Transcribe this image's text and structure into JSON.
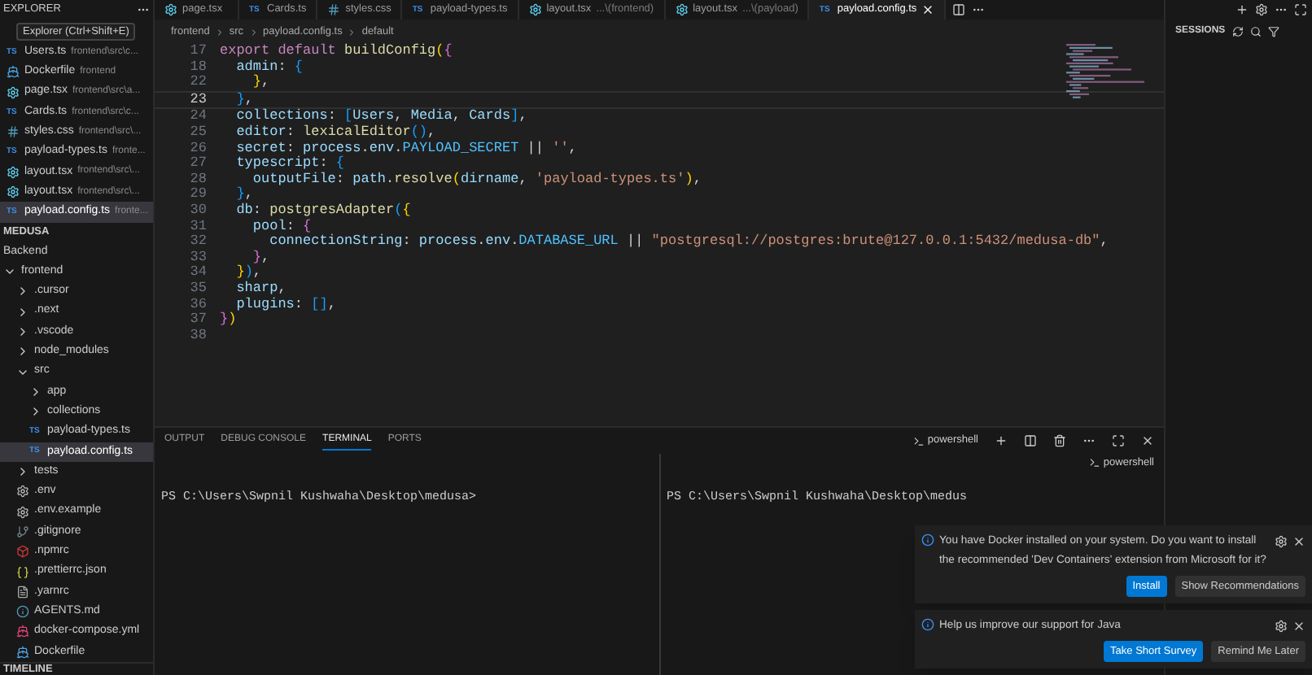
{
  "sidebar": {
    "title": "EXPLORER",
    "tooltip": "Explorer (Ctrl+Shift+E)",
    "open_editors": [
      {
        "name": "Users.ts",
        "detail": "frontend\\src\\c...",
        "kind": "ts",
        "badge": "TS",
        "selected": false
      },
      {
        "name": "Dockerfile",
        "detail": "frontend",
        "kind": "docker",
        "selected": false
      },
      {
        "name": "page.tsx",
        "detail": "frontend\\src\\a...",
        "kind": "react",
        "selected": false
      },
      {
        "name": "Cards.ts",
        "detail": "frontend\\src\\c...",
        "kind": "ts",
        "badge": "TS",
        "selected": false
      },
      {
        "name": "styles.css",
        "detail": "frontend\\src\\...",
        "kind": "css",
        "selected": false
      },
      {
        "name": "payload-types.ts",
        "detail": "fronte...",
        "kind": "ts",
        "badge": "TS",
        "selected": false
      },
      {
        "name": "layout.tsx",
        "detail": "frontend\\src\\...",
        "kind": "react",
        "selected": false
      },
      {
        "name": "layout.tsx",
        "detail": "frontend\\src\\...",
        "kind": "react",
        "selected": false
      },
      {
        "name": "payload.config.ts",
        "detail": "fronte...",
        "kind": "ts",
        "badge": "TS",
        "selected": true
      }
    ],
    "workspace": "MEDUSA",
    "tree": [
      {
        "name": "Backend",
        "kind": "plain",
        "selected": false
      },
      {
        "name": "frontend",
        "kind": "folder",
        "expanded": true,
        "selected": false,
        "children": [
          {
            "name": ".cursor",
            "kind": "folder",
            "expanded": false,
            "selected": false
          },
          {
            "name": ".next",
            "kind": "folder",
            "expanded": false,
            "selected": false
          },
          {
            "name": ".vscode",
            "kind": "folder",
            "expanded": false,
            "selected": false
          },
          {
            "name": "node_modules",
            "kind": "folder",
            "expanded": false,
            "selected": false
          },
          {
            "name": "src",
            "kind": "folder",
            "expanded": true,
            "selected": false,
            "children": [
              {
                "name": "app",
                "kind": "folder",
                "expanded": false,
                "selected": false
              },
              {
                "name": "collections",
                "kind": "folder",
                "expanded": false,
                "selected": false
              },
              {
                "name": "payload-types.ts",
                "kind": "ts",
                "badge": "TS",
                "selected": false
              },
              {
                "name": "payload.config.ts",
                "kind": "ts",
                "badge": "TS",
                "selected": true
              }
            ]
          },
          {
            "name": "tests",
            "kind": "folder",
            "expanded": false,
            "selected": false
          },
          {
            "name": ".env",
            "kind": "gear",
            "selected": false
          },
          {
            "name": ".env.example",
            "kind": "gear",
            "selected": false
          },
          {
            "name": ".gitignore",
            "kind": "git",
            "selected": false
          },
          {
            "name": ".npmrc",
            "kind": "npm",
            "selected": false
          },
          {
            "name": ".prettierrc.json",
            "kind": "json",
            "selected": false
          },
          {
            "name": ".yarnrc",
            "kind": "text",
            "selected": false
          },
          {
            "name": "AGENTS.md",
            "kind": "md",
            "selected": false
          },
          {
            "name": "docker-compose.yml",
            "kind": "compose",
            "selected": false
          },
          {
            "name": "Dockerfile",
            "kind": "docker",
            "selected": false
          }
        ]
      }
    ],
    "footer": "TIMELINE"
  },
  "tabs": [
    {
      "label": "page.tsx",
      "kind": "react",
      "selected": false
    },
    {
      "label": "Cards.ts",
      "kind": "ts",
      "badge": "TS",
      "selected": false
    },
    {
      "label": "styles.css",
      "kind": "css",
      "selected": false
    },
    {
      "label": "payload-types.ts",
      "kind": "ts",
      "badge": "TS",
      "selected": false
    },
    {
      "label": "layout.tsx",
      "detail": "...\\(frontend)",
      "kind": "react",
      "selected": false
    },
    {
      "label": "layout.tsx",
      "detail": "...\\(payload)",
      "kind": "react",
      "selected": false
    },
    {
      "label": "payload.config.ts",
      "kind": "ts",
      "badge": "TS",
      "selected": true
    }
  ],
  "breadcrumb": [
    "frontend",
    "src",
    "payload.config.ts",
    "default"
  ],
  "code": [
    {
      "number": "17",
      "current": false,
      "tokens": [
        {
          "text": "export default ",
          "kind": "keyword"
        },
        {
          "text": "buildConfig",
          "kind": "function"
        },
        {
          "text": "(",
          "kind": "bracket1"
        },
        {
          "text": "{",
          "kind": "bracket2"
        }
      ]
    },
    {
      "number": "18",
      "current": false,
      "tokens": [
        {
          "text": "  admin",
          "kind": "property"
        },
        {
          "text": ": ",
          "kind": "plain"
        },
        {
          "text": "{",
          "kind": "bracket3"
        }
      ]
    },
    {
      "number": "22",
      "current": false,
      "tokens": [
        {
          "text": "    }",
          "kind": "bracket1"
        },
        {
          "text": ",",
          "kind": "plain"
        }
      ]
    },
    {
      "number": "23",
      "current": true,
      "tokens": [
        {
          "text": "  }",
          "kind": "bracket3"
        },
        {
          "text": ",",
          "kind": "plain"
        }
      ]
    },
    {
      "number": "24",
      "current": false,
      "tokens": [
        {
          "text": "  collections",
          "kind": "property"
        },
        {
          "text": ": ",
          "kind": "plain"
        },
        {
          "text": "[",
          "kind": "bracket3"
        },
        {
          "text": "Users",
          "kind": "property"
        },
        {
          "text": ", ",
          "kind": "plain"
        },
        {
          "text": "Media",
          "kind": "property"
        },
        {
          "text": ", ",
          "kind": "plain"
        },
        {
          "text": "Cards",
          "kind": "property"
        },
        {
          "text": "]",
          "kind": "bracket3"
        },
        {
          "text": ",",
          "kind": "plain"
        }
      ]
    },
    {
      "number": "25",
      "current": false,
      "tokens": [
        {
          "text": "  editor",
          "kind": "property"
        },
        {
          "text": ": ",
          "kind": "plain"
        },
        {
          "text": "lexicalEditor",
          "kind": "function"
        },
        {
          "text": "()",
          "kind": "bracket3"
        },
        {
          "text": ",",
          "kind": "plain"
        }
      ]
    },
    {
      "number": "26",
      "current": false,
      "tokens": [
        {
          "text": "  secret",
          "kind": "property"
        },
        {
          "text": ": ",
          "kind": "plain"
        },
        {
          "text": "process",
          "kind": "property"
        },
        {
          "text": ".",
          "kind": "plain"
        },
        {
          "text": "env",
          "kind": "property"
        },
        {
          "text": ".",
          "kind": "plain"
        },
        {
          "text": "PAYLOAD_SECRET",
          "kind": "constant"
        },
        {
          "text": " || ",
          "kind": "plain"
        },
        {
          "text": "''",
          "kind": "string"
        },
        {
          "text": ",",
          "kind": "plain"
        }
      ]
    },
    {
      "number": "27",
      "current": false,
      "tokens": [
        {
          "text": "  typescript",
          "kind": "property"
        },
        {
          "text": ": ",
          "kind": "plain"
        },
        {
          "text": "{",
          "kind": "bracket3"
        }
      ]
    },
    {
      "number": "28",
      "current": false,
      "tokens": [
        {
          "text": "    outputFile",
          "kind": "property"
        },
        {
          "text": ": ",
          "kind": "plain"
        },
        {
          "text": "path",
          "kind": "property"
        },
        {
          "text": ".",
          "kind": "plain"
        },
        {
          "text": "resolve",
          "kind": "function"
        },
        {
          "text": "(",
          "kind": "bracket1"
        },
        {
          "text": "dirname",
          "kind": "property"
        },
        {
          "text": ", ",
          "kind": "plain"
        },
        {
          "text": "'payload-types.ts'",
          "kind": "string"
        },
        {
          "text": ")",
          "kind": "bracket1"
        },
        {
          "text": ",",
          "kind": "plain"
        }
      ]
    },
    {
      "number": "29",
      "current": false,
      "tokens": [
        {
          "text": "  }",
          "kind": "bracket3"
        },
        {
          "text": ",",
          "kind": "plain"
        }
      ]
    },
    {
      "number": "30",
      "current": false,
      "tokens": [
        {
          "text": "  db",
          "kind": "property"
        },
        {
          "text": ": ",
          "kind": "plain"
        },
        {
          "text": "postgresAdapter",
          "kind": "function"
        },
        {
          "text": "(",
          "kind": "bracket3"
        },
        {
          "text": "{",
          "kind": "bracket1"
        }
      ]
    },
    {
      "number": "31",
      "current": false,
      "tokens": [
        {
          "text": "    pool",
          "kind": "property"
        },
        {
          "text": ": ",
          "kind": "plain"
        },
        {
          "text": "{",
          "kind": "bracket2"
        }
      ]
    },
    {
      "number": "32",
      "current": false,
      "tokens": [
        {
          "text": "      connectionString",
          "kind": "property"
        },
        {
          "text": ": ",
          "kind": "plain"
        },
        {
          "text": "process",
          "kind": "property"
        },
        {
          "text": ".",
          "kind": "plain"
        },
        {
          "text": "env",
          "kind": "property"
        },
        {
          "text": ".",
          "kind": "plain"
        },
        {
          "text": "DATABASE_URL",
          "kind": "constant"
        },
        {
          "text": " || ",
          "kind": "plain"
        },
        {
          "text": "\"postgresql://postgres:brute@127.0.0.1:5432/medusa-db\"",
          "kind": "string"
        },
        {
          "text": ",",
          "kind": "plain"
        }
      ]
    },
    {
      "number": "33",
      "current": false,
      "tokens": [
        {
          "text": "    }",
          "kind": "bracket2"
        },
        {
          "text": ",",
          "kind": "plain"
        }
      ]
    },
    {
      "number": "34",
      "current": false,
      "tokens": [
        {
          "text": "  }",
          "kind": "bracket1"
        },
        {
          "text": ")",
          "kind": "bracket3"
        },
        {
          "text": ",",
          "kind": "plain"
        }
      ]
    },
    {
      "number": "35",
      "current": false,
      "tokens": [
        {
          "text": "  sharp",
          "kind": "property"
        },
        {
          "text": ",",
          "kind": "plain"
        }
      ]
    },
    {
      "number": "36",
      "current": false,
      "tokens": [
        {
          "text": "  plugins",
          "kind": "property"
        },
        {
          "text": ": ",
          "kind": "plain"
        },
        {
          "text": "[]",
          "kind": "bracket3"
        },
        {
          "text": ",",
          "kind": "plain"
        }
      ]
    },
    {
      "number": "37",
      "current": false,
      "tokens": [
        {
          "text": "}",
          "kind": "bracket2"
        },
        {
          "text": ")",
          "kind": "bracket1"
        }
      ]
    },
    {
      "number": "38",
      "current": false
    }
  ],
  "panel": {
    "tabs": [
      {
        "label": "OUTPUT",
        "selected": false
      },
      {
        "label": "DEBUG CONSOLE",
        "selected": false
      },
      {
        "label": "TERMINAL",
        "selected": true
      },
      {
        "label": "PORTS",
        "selected": false
      }
    ],
    "shell": "powershell",
    "shell_hover": "powershell",
    "terminals": [
      "PS C:\\Users\\Swpnil Kushwaha\\Desktop\\medusa>",
      "PS C:\\Users\\Swpnil Kushwaha\\Desktop\\medus"
    ]
  },
  "sessions": {
    "title": "SESSIONS"
  },
  "notifications": [
    {
      "message": "You have Docker installed on your system. Do you want to install the recommended 'Dev Containers' extension from Microsoft for it?",
      "actions": [
        {
          "label": "Install",
          "primary": true
        },
        {
          "label": "Show Recommendations",
          "primary": false
        }
      ]
    },
    {
      "message": "Help us improve our support for Java",
      "actions": [
        {
          "label": "Take Short Survey",
          "primary": true
        },
        {
          "label": "Remind Me Later",
          "primary": false
        }
      ]
    }
  ]
}
